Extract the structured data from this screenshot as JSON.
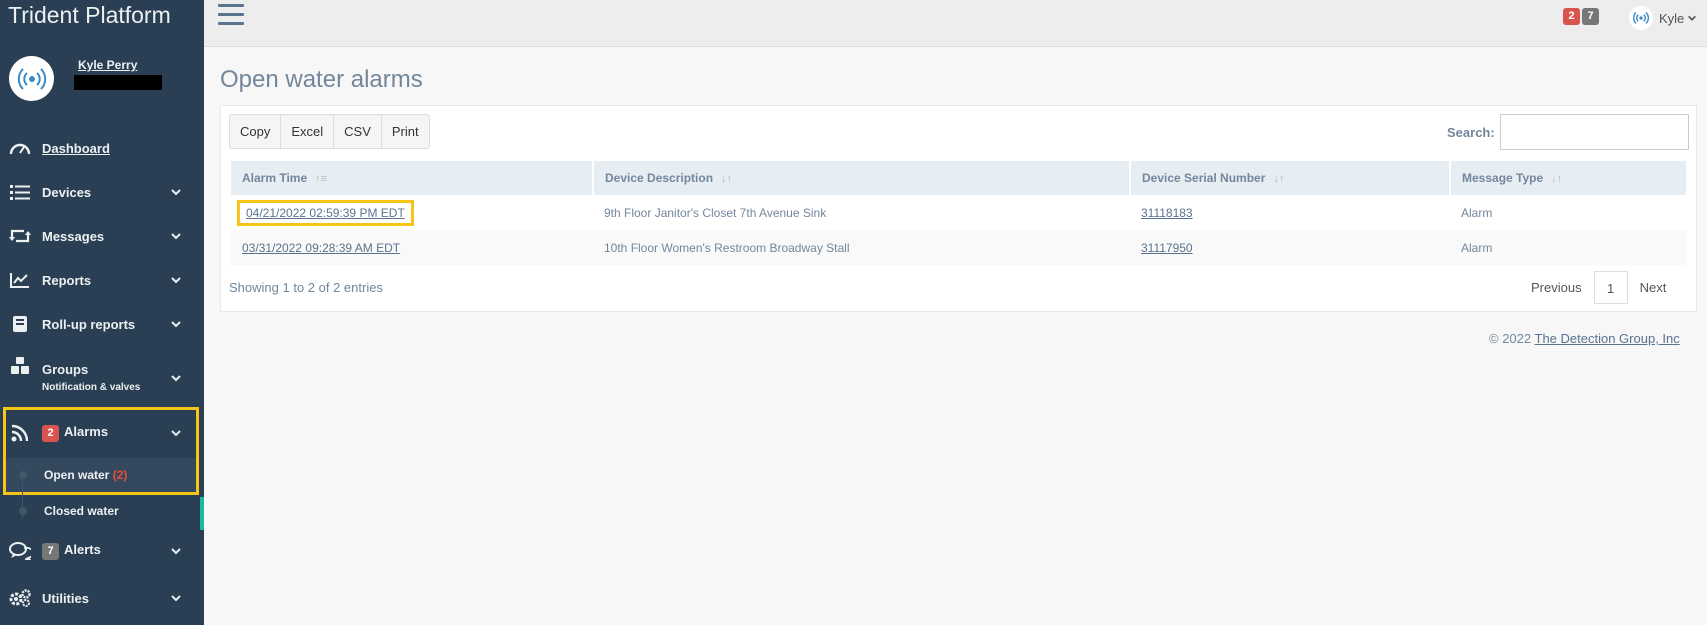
{
  "brand": "Trident Platform",
  "profile": {
    "name": "Kyle Perry"
  },
  "nav": [
    {
      "label": "Dashboard",
      "icon": "dashboard-icon"
    },
    {
      "label": "Devices",
      "icon": "list-icon"
    },
    {
      "label": "Messages",
      "icon": "retweet-icon"
    },
    {
      "label": "Reports",
      "icon": "chart-icon"
    },
    {
      "label": "Roll-up reports",
      "icon": "book-icon"
    },
    {
      "label": "Groups",
      "sub": "Notification & valves",
      "icon": "cubes-icon"
    },
    {
      "label": "Alarms",
      "badge": "2",
      "icon": "rss-icon"
    },
    {
      "label": "Alerts",
      "badge": "7",
      "icon": "comments-icon"
    },
    {
      "label": "Utilities",
      "icon": "cogs-icon"
    }
  ],
  "alarm_sub": [
    {
      "label": "Open water",
      "count": "(2)"
    },
    {
      "label": "Closed water"
    }
  ],
  "topbar": {
    "badge_red": "2",
    "badge_gray": "7",
    "user": "Kyle"
  },
  "page_title": "Open water alarms",
  "buttons": [
    "Copy",
    "Excel",
    "CSV",
    "Print"
  ],
  "search": {
    "label": "Search:",
    "placeholder": ""
  },
  "table": {
    "headers": [
      "Alarm Time",
      "Device Description",
      "Device Serial Number",
      "Message Type"
    ],
    "rows": [
      {
        "time": "04/21/2022 02:59:39 PM EDT",
        "desc": "9th Floor Janitor's Closet 7th Avenue Sink",
        "serial": "31118183",
        "type": "Alarm"
      },
      {
        "time": "03/31/2022 09:28:39 AM EDT",
        "desc": "10th Floor Women's Restroom Broadway Stall",
        "serial": "31117950",
        "type": "Alarm"
      }
    ]
  },
  "info": "Showing 1 to 2 of 2 entries",
  "pager": {
    "prev": "Previous",
    "page": "1",
    "next": "Next"
  },
  "footer": {
    "copy": "© 2022",
    "company": "The Detection Group, Inc"
  },
  "colors": {
    "sidebar": "#2a3f54",
    "highlight": "#f5c518",
    "badge_red": "#d9534f",
    "accent": "#1abb9c"
  }
}
